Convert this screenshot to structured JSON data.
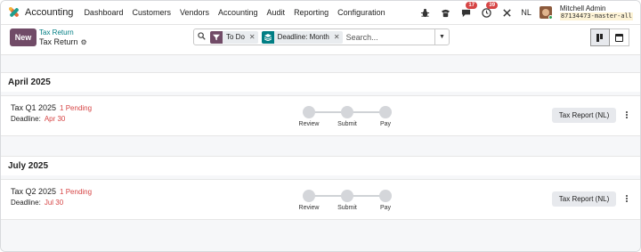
{
  "navbar": {
    "app_name": "Accounting",
    "menu": [
      "Dashboard",
      "Customers",
      "Vendors",
      "Accounting",
      "Audit",
      "Reporting",
      "Configuration"
    ],
    "icons": [
      "bug-icon",
      "phone-icon",
      "chat-icon",
      "activity-clock-icon",
      "tools-icon"
    ],
    "chat_badge": "17",
    "activity_badge": "39",
    "language": "NL",
    "user_name": "Mitchell Admin",
    "database": "87134473-master-all",
    "badge_color": "#d64545"
  },
  "control": {
    "new_label": "New",
    "breadcrumb_parent": "Tax Return",
    "breadcrumb_current": "Tax Return",
    "search": {
      "facets": [
        {
          "type": "filter",
          "value": "To Do"
        },
        {
          "type": "group",
          "value": "Deadline: Month"
        }
      ],
      "placeholder": "Search..."
    },
    "views": [
      "kanban",
      "calendar"
    ],
    "active_view": "kanban"
  },
  "groups": [
    {
      "title": "April 2025",
      "records": [
        {
          "name": "Tax Q1 2025",
          "pending": "1 Pending",
          "deadline_label": "Deadline:",
          "deadline": "Apr 30",
          "steps": [
            "Review",
            "Submit",
            "Pay"
          ],
          "action": "Tax Report (NL)"
        }
      ]
    },
    {
      "title": "July 2025",
      "records": [
        {
          "name": "Tax Q2 2025",
          "pending": "1 Pending",
          "deadline_label": "Deadline:",
          "deadline": "Jul 30",
          "steps": [
            "Review",
            "Submit",
            "Pay"
          ],
          "action": "Tax Report (NL)"
        }
      ]
    }
  ],
  "colors": {
    "primary": "#714b67",
    "accent": "#017e84",
    "overdue": "#d64545"
  }
}
